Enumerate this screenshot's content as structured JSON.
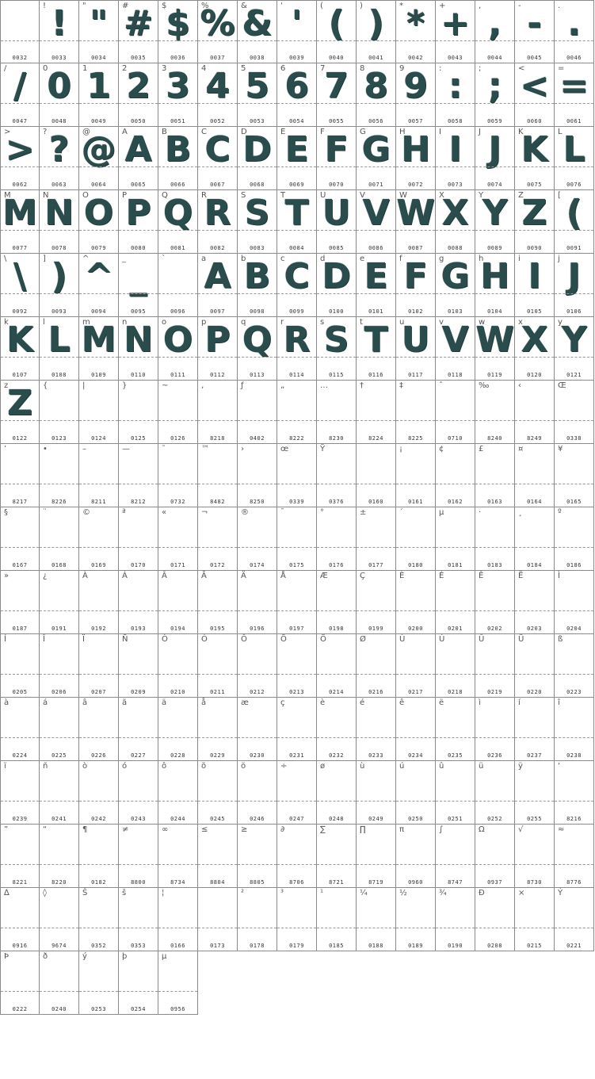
{
  "glyph_color": "#2b4c4c",
  "grid_color": "#8a8a8a",
  "cells": [
    {
      "char": "",
      "code": "0032",
      "glyph": ""
    },
    {
      "char": "!",
      "code": "0033",
      "glyph": "!"
    },
    {
      "char": "\"",
      "code": "0034",
      "glyph": "\""
    },
    {
      "char": "#",
      "code": "0035",
      "glyph": "#"
    },
    {
      "char": "$",
      "code": "0036",
      "glyph": "$"
    },
    {
      "char": "%",
      "code": "0037",
      "glyph": "%"
    },
    {
      "char": "&",
      "code": "0038",
      "glyph": "&"
    },
    {
      "char": "'",
      "code": "0039",
      "glyph": "'"
    },
    {
      "char": "(",
      "code": "0040",
      "glyph": "("
    },
    {
      "char": ")",
      "code": "0041",
      "glyph": ")"
    },
    {
      "char": "*",
      "code": "0042",
      "glyph": "*"
    },
    {
      "char": "+",
      "code": "0043",
      "glyph": "+"
    },
    {
      "char": ",",
      "code": "0044",
      "glyph": ","
    },
    {
      "char": "-",
      "code": "0045",
      "glyph": "-"
    },
    {
      "char": ".",
      "code": "0046",
      "glyph": "."
    },
    {
      "char": "/",
      "code": "0047",
      "glyph": "/"
    },
    {
      "char": "0",
      "code": "0048",
      "glyph": "0"
    },
    {
      "char": "1",
      "code": "0049",
      "glyph": "1"
    },
    {
      "char": "2",
      "code": "0050",
      "glyph": "2"
    },
    {
      "char": "3",
      "code": "0051",
      "glyph": "3"
    },
    {
      "char": "4",
      "code": "0052",
      "glyph": "4"
    },
    {
      "char": "5",
      "code": "0053",
      "glyph": "5"
    },
    {
      "char": "6",
      "code": "0054",
      "glyph": "6"
    },
    {
      "char": "7",
      "code": "0055",
      "glyph": "7"
    },
    {
      "char": "8",
      "code": "0056",
      "glyph": "8"
    },
    {
      "char": "9",
      "code": "0057",
      "glyph": "9"
    },
    {
      "char": ":",
      "code": "0058",
      "glyph": ":"
    },
    {
      "char": ";",
      "code": "0059",
      "glyph": ";"
    },
    {
      "char": "<",
      "code": "0060",
      "glyph": "<"
    },
    {
      "char": "=",
      "code": "0061",
      "glyph": "="
    },
    {
      "char": ">",
      "code": "0062",
      "glyph": ">"
    },
    {
      "char": "?",
      "code": "0063",
      "glyph": "?"
    },
    {
      "char": "@",
      "code": "0064",
      "glyph": "@"
    },
    {
      "char": "A",
      "code": "0065",
      "glyph": "A"
    },
    {
      "char": "B",
      "code": "0066",
      "glyph": "B"
    },
    {
      "char": "C",
      "code": "0067",
      "glyph": "C"
    },
    {
      "char": "D",
      "code": "0068",
      "glyph": "D"
    },
    {
      "char": "E",
      "code": "0069",
      "glyph": "E"
    },
    {
      "char": "F",
      "code": "0070",
      "glyph": "F"
    },
    {
      "char": "G",
      "code": "0071",
      "glyph": "G"
    },
    {
      "char": "H",
      "code": "0072",
      "glyph": "H"
    },
    {
      "char": "I",
      "code": "0073",
      "glyph": "I"
    },
    {
      "char": "J",
      "code": "0074",
      "glyph": "J"
    },
    {
      "char": "K",
      "code": "0075",
      "glyph": "K"
    },
    {
      "char": "L",
      "code": "0076",
      "glyph": "L"
    },
    {
      "char": "M",
      "code": "0077",
      "glyph": "M"
    },
    {
      "char": "N",
      "code": "0078",
      "glyph": "N"
    },
    {
      "char": "O",
      "code": "0079",
      "glyph": "O"
    },
    {
      "char": "P",
      "code": "0080",
      "glyph": "P"
    },
    {
      "char": "Q",
      "code": "0081",
      "glyph": "Q"
    },
    {
      "char": "R",
      "code": "0082",
      "glyph": "R"
    },
    {
      "char": "S",
      "code": "0083",
      "glyph": "S"
    },
    {
      "char": "T",
      "code": "0084",
      "glyph": "T"
    },
    {
      "char": "U",
      "code": "0085",
      "glyph": "U"
    },
    {
      "char": "V",
      "code": "0086",
      "glyph": "V"
    },
    {
      "char": "W",
      "code": "0087",
      "glyph": "W"
    },
    {
      "char": "X",
      "code": "0088",
      "glyph": "X"
    },
    {
      "char": "Y",
      "code": "0089",
      "glyph": "Y"
    },
    {
      "char": "Z",
      "code": "0090",
      "glyph": "Z"
    },
    {
      "char": "[",
      "code": "0091",
      "glyph": "("
    },
    {
      "char": "\\",
      "code": "0092",
      "glyph": "\\"
    },
    {
      "char": "]",
      "code": "0093",
      "glyph": ")"
    },
    {
      "char": "^",
      "code": "0094",
      "glyph": "^"
    },
    {
      "char": "_",
      "code": "0095",
      "glyph": "_"
    },
    {
      "char": "`",
      "code": "0096",
      "glyph": ""
    },
    {
      "char": "a",
      "code": "0097",
      "glyph": "A"
    },
    {
      "char": "b",
      "code": "0098",
      "glyph": "B"
    },
    {
      "char": "c",
      "code": "0099",
      "glyph": "C"
    },
    {
      "char": "d",
      "code": "0100",
      "glyph": "D"
    },
    {
      "char": "e",
      "code": "0101",
      "glyph": "E"
    },
    {
      "char": "f",
      "code": "0102",
      "glyph": "F"
    },
    {
      "char": "g",
      "code": "0103",
      "glyph": "G"
    },
    {
      "char": "h",
      "code": "0104",
      "glyph": "H"
    },
    {
      "char": "i",
      "code": "0105",
      "glyph": "I"
    },
    {
      "char": "j",
      "code": "0106",
      "glyph": "J"
    },
    {
      "char": "k",
      "code": "0107",
      "glyph": "K"
    },
    {
      "char": "l",
      "code": "0108",
      "glyph": "L"
    },
    {
      "char": "m",
      "code": "0109",
      "glyph": "M"
    },
    {
      "char": "n",
      "code": "0110",
      "glyph": "N"
    },
    {
      "char": "o",
      "code": "0111",
      "glyph": "O"
    },
    {
      "char": "p",
      "code": "0112",
      "glyph": "P"
    },
    {
      "char": "q",
      "code": "0113",
      "glyph": "Q"
    },
    {
      "char": "r",
      "code": "0114",
      "glyph": "R"
    },
    {
      "char": "s",
      "code": "0115",
      "glyph": "S"
    },
    {
      "char": "t",
      "code": "0116",
      "glyph": "T"
    },
    {
      "char": "u",
      "code": "0117",
      "glyph": "U"
    },
    {
      "char": "v",
      "code": "0118",
      "glyph": "V"
    },
    {
      "char": "w",
      "code": "0119",
      "glyph": "W"
    },
    {
      "char": "x",
      "code": "0120",
      "glyph": "X"
    },
    {
      "char": "y",
      "code": "0121",
      "glyph": "Y"
    },
    {
      "char": "z",
      "code": "0122",
      "glyph": "Z"
    },
    {
      "char": "{",
      "code": "0123",
      "glyph": ""
    },
    {
      "char": "|",
      "code": "0124",
      "glyph": ""
    },
    {
      "char": "}",
      "code": "0125",
      "glyph": ""
    },
    {
      "char": "~",
      "code": "0126",
      "glyph": ""
    },
    {
      "char": "‚",
      "code": "8218",
      "glyph": ""
    },
    {
      "char": "ƒ",
      "code": "0402",
      "glyph": ""
    },
    {
      "char": "„",
      "code": "8222",
      "glyph": ""
    },
    {
      "char": "…",
      "code": "8230",
      "glyph": ""
    },
    {
      "char": "†",
      "code": "8224",
      "glyph": ""
    },
    {
      "char": "‡",
      "code": "8225",
      "glyph": ""
    },
    {
      "char": "ˆ",
      "code": "0710",
      "glyph": ""
    },
    {
      "char": "‰",
      "code": "8240",
      "glyph": ""
    },
    {
      "char": "‹",
      "code": "8249",
      "glyph": ""
    },
    {
      "char": "Œ",
      "code": "0338",
      "glyph": ""
    },
    {
      "char": "’",
      "code": "8217",
      "glyph": ""
    },
    {
      "char": "•",
      "code": "8226",
      "glyph": ""
    },
    {
      "char": "–",
      "code": "8211",
      "glyph": ""
    },
    {
      "char": "—",
      "code": "8212",
      "glyph": ""
    },
    {
      "char": "˜",
      "code": "0732",
      "glyph": ""
    },
    {
      "char": "™",
      "code": "8482",
      "glyph": ""
    },
    {
      "char": "›",
      "code": "8250",
      "glyph": ""
    },
    {
      "char": "œ",
      "code": "0339",
      "glyph": ""
    },
    {
      "char": "Ÿ",
      "code": "0376",
      "glyph": ""
    },
    {
      "char": "",
      "code": "0160",
      "glyph": ""
    },
    {
      "char": "¡",
      "code": "0161",
      "glyph": ""
    },
    {
      "char": "¢",
      "code": "0162",
      "glyph": ""
    },
    {
      "char": "£",
      "code": "0163",
      "glyph": ""
    },
    {
      "char": "¤",
      "code": "0164",
      "glyph": ""
    },
    {
      "char": "¥",
      "code": "0165",
      "glyph": ""
    },
    {
      "char": "§",
      "code": "0167",
      "glyph": ""
    },
    {
      "char": "¨",
      "code": "0168",
      "glyph": ""
    },
    {
      "char": "©",
      "code": "0169",
      "glyph": ""
    },
    {
      "char": "ª",
      "code": "0170",
      "glyph": ""
    },
    {
      "char": "«",
      "code": "0171",
      "glyph": ""
    },
    {
      "char": "¬",
      "code": "0172",
      "glyph": ""
    },
    {
      "char": "®",
      "code": "0174",
      "glyph": ""
    },
    {
      "char": "¯",
      "code": "0175",
      "glyph": ""
    },
    {
      "char": "°",
      "code": "0176",
      "glyph": ""
    },
    {
      "char": "±",
      "code": "0177",
      "glyph": ""
    },
    {
      "char": "´",
      "code": "0180",
      "glyph": ""
    },
    {
      "char": "µ",
      "code": "0181",
      "glyph": ""
    },
    {
      "char": "·",
      "code": "0183",
      "glyph": ""
    },
    {
      "char": "¸",
      "code": "0184",
      "glyph": ""
    },
    {
      "char": "º",
      "code": "0186",
      "glyph": ""
    },
    {
      "char": "»",
      "code": "0187",
      "glyph": ""
    },
    {
      "char": "¿",
      "code": "0191",
      "glyph": ""
    },
    {
      "char": "À",
      "code": "0192",
      "glyph": ""
    },
    {
      "char": "Á",
      "code": "0193",
      "glyph": ""
    },
    {
      "char": "Â",
      "code": "0194",
      "glyph": ""
    },
    {
      "char": "Ã",
      "code": "0195",
      "glyph": ""
    },
    {
      "char": "Ä",
      "code": "0196",
      "glyph": ""
    },
    {
      "char": "Å",
      "code": "0197",
      "glyph": ""
    },
    {
      "char": "Æ",
      "code": "0198",
      "glyph": ""
    },
    {
      "char": "Ç",
      "code": "0199",
      "glyph": ""
    },
    {
      "char": "È",
      "code": "0200",
      "glyph": ""
    },
    {
      "char": "É",
      "code": "0201",
      "glyph": ""
    },
    {
      "char": "Ê",
      "code": "0202",
      "glyph": ""
    },
    {
      "char": "Ë",
      "code": "0203",
      "glyph": ""
    },
    {
      "char": "Ì",
      "code": "0204",
      "glyph": ""
    },
    {
      "char": "Í",
      "code": "0205",
      "glyph": ""
    },
    {
      "char": "Î",
      "code": "0206",
      "glyph": ""
    },
    {
      "char": "Ï",
      "code": "0207",
      "glyph": ""
    },
    {
      "char": "Ñ",
      "code": "0209",
      "glyph": ""
    },
    {
      "char": "Ò",
      "code": "0210",
      "glyph": ""
    },
    {
      "char": "Ó",
      "code": "0211",
      "glyph": ""
    },
    {
      "char": "Ô",
      "code": "0212",
      "glyph": ""
    },
    {
      "char": "Õ",
      "code": "0213",
      "glyph": ""
    },
    {
      "char": "Ö",
      "code": "0214",
      "glyph": ""
    },
    {
      "char": "Ø",
      "code": "0216",
      "glyph": ""
    },
    {
      "char": "Ù",
      "code": "0217",
      "glyph": ""
    },
    {
      "char": "Ú",
      "code": "0218",
      "glyph": ""
    },
    {
      "char": "Û",
      "code": "0219",
      "glyph": ""
    },
    {
      "char": "Ü",
      "code": "0220",
      "glyph": ""
    },
    {
      "char": "ß",
      "code": "0223",
      "glyph": ""
    },
    {
      "char": "à",
      "code": "0224",
      "glyph": ""
    },
    {
      "char": "á",
      "code": "0225",
      "glyph": ""
    },
    {
      "char": "â",
      "code": "0226",
      "glyph": ""
    },
    {
      "char": "ã",
      "code": "0227",
      "glyph": ""
    },
    {
      "char": "ä",
      "code": "0228",
      "glyph": ""
    },
    {
      "char": "å",
      "code": "0229",
      "glyph": ""
    },
    {
      "char": "æ",
      "code": "0230",
      "glyph": ""
    },
    {
      "char": "ç",
      "code": "0231",
      "glyph": ""
    },
    {
      "char": "è",
      "code": "0232",
      "glyph": ""
    },
    {
      "char": "é",
      "code": "0233",
      "glyph": ""
    },
    {
      "char": "ê",
      "code": "0234",
      "glyph": ""
    },
    {
      "char": "ë",
      "code": "0235",
      "glyph": ""
    },
    {
      "char": "ì",
      "code": "0236",
      "glyph": ""
    },
    {
      "char": "í",
      "code": "0237",
      "glyph": ""
    },
    {
      "char": "î",
      "code": "0238",
      "glyph": ""
    },
    {
      "char": "ï",
      "code": "0239",
      "glyph": ""
    },
    {
      "char": "ñ",
      "code": "0241",
      "glyph": ""
    },
    {
      "char": "ò",
      "code": "0242",
      "glyph": ""
    },
    {
      "char": "ó",
      "code": "0243",
      "glyph": ""
    },
    {
      "char": "ô",
      "code": "0244",
      "glyph": ""
    },
    {
      "char": "õ",
      "code": "0245",
      "glyph": ""
    },
    {
      "char": "ö",
      "code": "0246",
      "glyph": ""
    },
    {
      "char": "÷",
      "code": "0247",
      "glyph": ""
    },
    {
      "char": "ø",
      "code": "0248",
      "glyph": ""
    },
    {
      "char": "ù",
      "code": "0249",
      "glyph": ""
    },
    {
      "char": "ú",
      "code": "0250",
      "glyph": ""
    },
    {
      "char": "û",
      "code": "0251",
      "glyph": ""
    },
    {
      "char": "ü",
      "code": "0252",
      "glyph": ""
    },
    {
      "char": "ÿ",
      "code": "0255",
      "glyph": ""
    },
    {
      "char": "‘",
      "code": "8216",
      "glyph": ""
    },
    {
      "char": "”",
      "code": "8221",
      "glyph": ""
    },
    {
      "char": "“",
      "code": "8220",
      "glyph": ""
    },
    {
      "char": "¶",
      "code": "0182",
      "glyph": ""
    },
    {
      "char": "≠",
      "code": "8800",
      "glyph": ""
    },
    {
      "char": "∞",
      "code": "8734",
      "glyph": ""
    },
    {
      "char": "≤",
      "code": "8804",
      "glyph": ""
    },
    {
      "char": "≥",
      "code": "8805",
      "glyph": ""
    },
    {
      "char": "∂",
      "code": "8706",
      "glyph": ""
    },
    {
      "char": "∑",
      "code": "8721",
      "glyph": ""
    },
    {
      "char": "∏",
      "code": "8719",
      "glyph": ""
    },
    {
      "char": "π",
      "code": "0960",
      "glyph": ""
    },
    {
      "char": "∫",
      "code": "8747",
      "glyph": ""
    },
    {
      "char": "Ω",
      "code": "0937",
      "glyph": ""
    },
    {
      "char": "√",
      "code": "8730",
      "glyph": ""
    },
    {
      "char": "≈",
      "code": "8776",
      "glyph": ""
    },
    {
      "char": "∆",
      "code": "0916",
      "glyph": ""
    },
    {
      "char": "◊",
      "code": "9674",
      "glyph": ""
    },
    {
      "char": "Š",
      "code": "0352",
      "glyph": ""
    },
    {
      "char": "š",
      "code": "0353",
      "glyph": ""
    },
    {
      "char": "¦",
      "code": "0166",
      "glyph": ""
    },
    {
      "char": "",
      "code": "0173",
      "glyph": ""
    },
    {
      "char": "²",
      "code": "0178",
      "glyph": ""
    },
    {
      "char": "³",
      "code": "0179",
      "glyph": ""
    },
    {
      "char": "¹",
      "code": "0185",
      "glyph": ""
    },
    {
      "char": "¼",
      "code": "0188",
      "glyph": ""
    },
    {
      "char": "½",
      "code": "0189",
      "glyph": ""
    },
    {
      "char": "¾",
      "code": "0190",
      "glyph": ""
    },
    {
      "char": "Ð",
      "code": "0208",
      "glyph": ""
    },
    {
      "char": "×",
      "code": "0215",
      "glyph": ""
    },
    {
      "char": "Ý",
      "code": "0221",
      "glyph": ""
    },
    {
      "char": "Þ",
      "code": "0222",
      "glyph": ""
    },
    {
      "char": "ð",
      "code": "0240",
      "glyph": ""
    },
    {
      "char": "ý",
      "code": "0253",
      "glyph": ""
    },
    {
      "char": "þ",
      "code": "0254",
      "glyph": ""
    },
    {
      "char": "µ",
      "code": "0956",
      "glyph": ""
    }
  ]
}
